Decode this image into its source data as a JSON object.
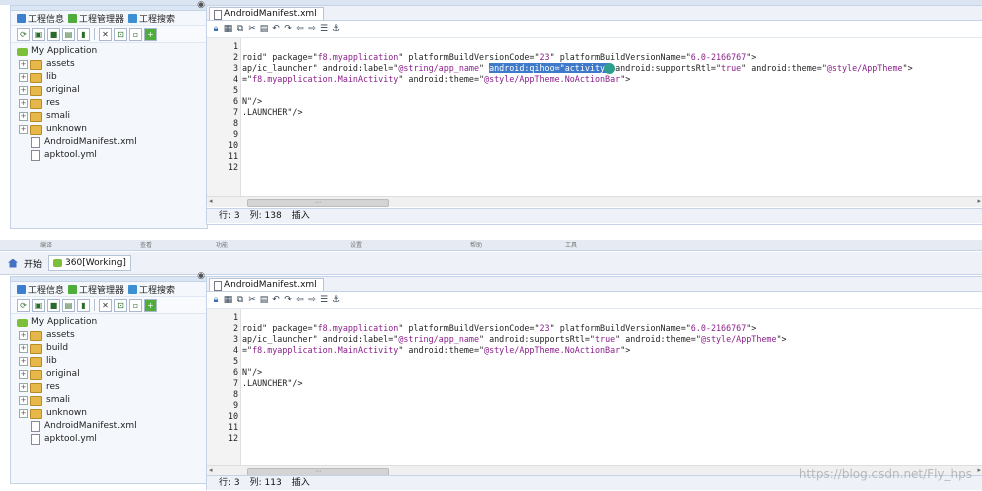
{
  "top": {
    "left": {
      "tabs": [
        "工程信息",
        "工程管理器",
        "工程搜索"
      ],
      "tree": [
        {
          "label": "My Application",
          "kind": "app"
        },
        {
          "label": "assets",
          "kind": "folder"
        },
        {
          "label": "lib",
          "kind": "folder"
        },
        {
          "label": "original",
          "kind": "folder"
        },
        {
          "label": "res",
          "kind": "folder"
        },
        {
          "label": "smali",
          "kind": "folder"
        },
        {
          "label": "unknown",
          "kind": "folder"
        },
        {
          "label": "AndroidManifest.xml",
          "kind": "file"
        },
        {
          "label": "apktool.yml",
          "kind": "file"
        }
      ]
    },
    "editor": {
      "tab": "AndroidManifest.xml",
      "line_numbers": [
        "1",
        "2",
        "3",
        "4",
        "5",
        "6",
        "7",
        "8",
        "9",
        "10",
        "11",
        "12"
      ],
      "line2": {
        "a": "roid\" package=\"",
        "b": "f8.myapplication",
        "c": "\" platformBuildVersionCode=\"",
        "d": "23",
        "e": "\" platformBuildVersionName=\"",
        "f": "6.0-2166767",
        "g": "\">"
      },
      "line3": {
        "a": "ap/ic_launcher\" android:label=\"",
        "b": "@string/app_name",
        "c": "\" ",
        "hl": "android:qihoo=\"activity\"",
        "d": "android:supportsRtl=\"",
        "e": "true",
        "f": "\" android:theme=\"",
        "g": "@style/AppTheme",
        "h": "\">"
      },
      "line4": {
        "a": "=\"",
        "b": "f8.myapplication.MainActivity",
        "c": "\" android:theme=\"",
        "d": "@style/AppTheme.NoActionBar",
        "e": "\">"
      },
      "line6": "N\"/>",
      "line7": ".LAUNCHER\"/>",
      "status": {
        "row": "行: 3",
        "col": "列: 138",
        "mode": "插入"
      }
    }
  },
  "ribbon": [
    "编译",
    "查看",
    "功能",
    "设置",
    "帮助",
    "工具"
  ],
  "appbar": {
    "home": "开始",
    "working": "360[Working]"
  },
  "bottom": {
    "left": {
      "tabs": [
        "工程信息",
        "工程管理器",
        "工程搜索"
      ],
      "tree": [
        {
          "label": "My Application",
          "kind": "app"
        },
        {
          "label": "assets",
          "kind": "folder"
        },
        {
          "label": "build",
          "kind": "folder"
        },
        {
          "label": "lib",
          "kind": "folder"
        },
        {
          "label": "original",
          "kind": "folder"
        },
        {
          "label": "res",
          "kind": "folder"
        },
        {
          "label": "smali",
          "kind": "folder"
        },
        {
          "label": "unknown",
          "kind": "folder"
        },
        {
          "label": "AndroidManifest.xml",
          "kind": "file"
        },
        {
          "label": "apktool.yml",
          "kind": "file"
        }
      ]
    },
    "editor": {
      "tab": "AndroidManifest.xml",
      "line_numbers": [
        "1",
        "2",
        "3",
        "4",
        "5",
        "6",
        "7",
        "8",
        "9",
        "10",
        "11",
        "12"
      ],
      "line2": {
        "a": "roid\" package=\"",
        "b": "f8.myapplication",
        "c": "\" platformBuildVersionCode=\"",
        "d": "23",
        "e": "\" platformBuildVersionName=\"",
        "f": "6.0-2166767",
        "g": "\">"
      },
      "line3": {
        "a": "ap/ic_launcher\" android:label=\"",
        "b": "@string/app_name",
        "c": "\" android:supportsRtl=\"",
        "d": "true",
        "e": "\" android:theme=\"",
        "f": "@style/AppTheme",
        "g": "\">"
      },
      "line4": {
        "a": "=\"",
        "b": "f8.myapplication.MainActivity",
        "c": "\" android:theme=\"",
        "d": "@style/AppTheme.NoActionBar",
        "e": "\">"
      },
      "line6": "N\"/>",
      "line7": ".LAUNCHER\"/>",
      "status": {
        "row": "行: 3",
        "col": "列: 113",
        "mode": "插入"
      }
    }
  },
  "watermark": "https://blog.csdn.net/Fly_hps"
}
